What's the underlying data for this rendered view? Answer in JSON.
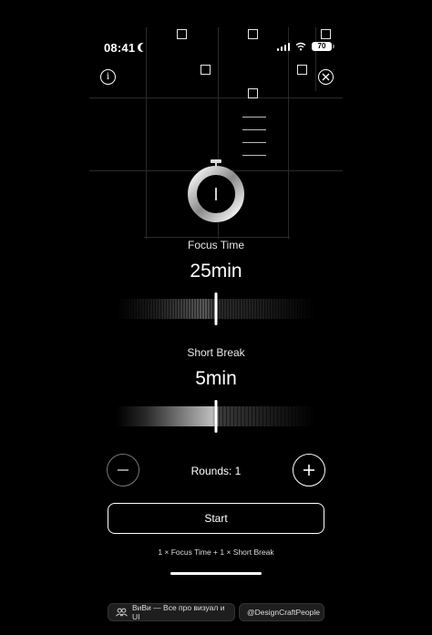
{
  "status_bar": {
    "time": "08:41",
    "battery": "70"
  },
  "focus": {
    "label": "Focus Time",
    "value": "25min"
  },
  "short_break": {
    "label": "Short Break",
    "value": "5min"
  },
  "rounds": {
    "label": "Rounds: 1"
  },
  "start_button": {
    "label": "Start"
  },
  "summary": "1 × Focus Time + 1 × Short Break",
  "footer": {
    "left_text": "ВиВи — Все про визуал и UI",
    "right_text": "@DesignCraftPeople"
  },
  "icons": {
    "info": "info-icon",
    "close": "close-icon",
    "minus": "minus-icon",
    "plus": "plus-icon"
  },
  "colors": {
    "background": "#000000",
    "foreground": "#ffffff",
    "grid": "#2a2a2a"
  }
}
